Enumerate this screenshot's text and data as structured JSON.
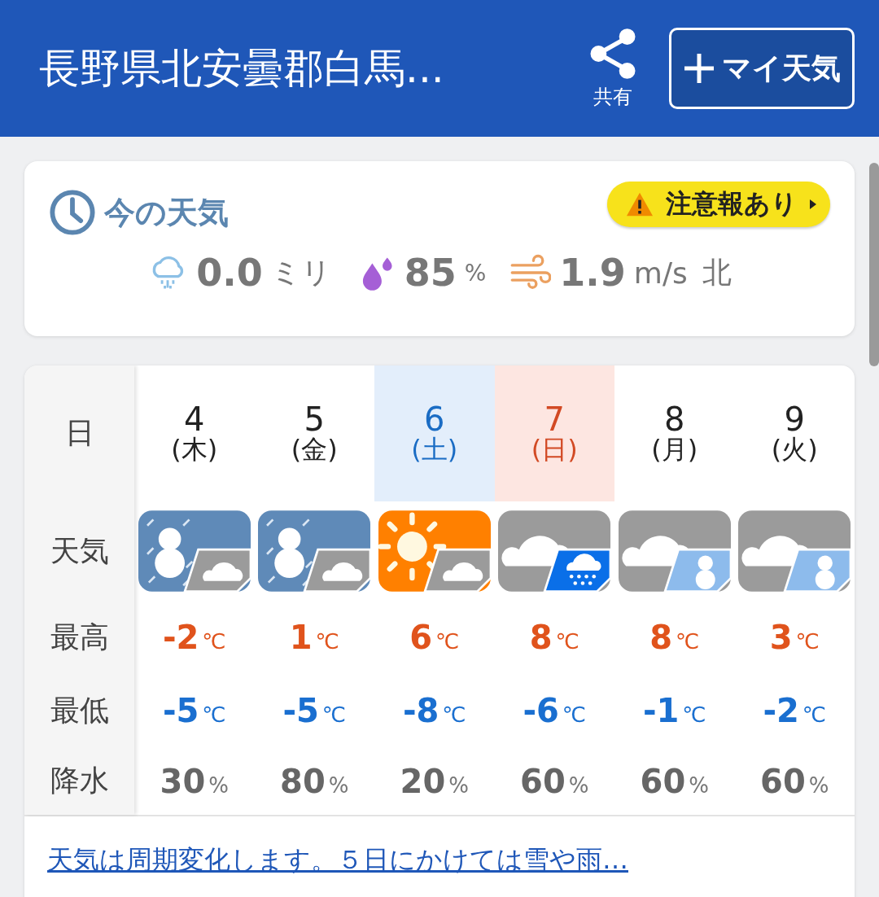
{
  "header": {
    "title": "長野県北安曇郡白馬...",
    "share_label": "共有",
    "my_weather_button": "マイ天気"
  },
  "current": {
    "title": "今の天気",
    "alert": "注意報あり",
    "precip_value": "0.0",
    "precip_unit": "ミリ",
    "humidity_value": "85",
    "humidity_unit": "%",
    "wind_value": "1.9",
    "wind_unit": "m/s",
    "wind_dir": "北"
  },
  "forecast": {
    "row_labels": [
      "日",
      "天気",
      "最高",
      "最低",
      "降水"
    ],
    "days": [
      {
        "date": "4",
        "weekday": "(木)",
        "kind": "weekday",
        "weather": [
          {
            "kind": "snow"
          },
          {
            "kind": "cloudy"
          }
        ],
        "high": "-2",
        "low": "-5",
        "precip": "30"
      },
      {
        "date": "5",
        "weekday": "(金)",
        "kind": "weekday",
        "weather": [
          {
            "kind": "snow"
          },
          {
            "kind": "cloudy"
          }
        ],
        "high": "1",
        "low": "-5",
        "precip": "80"
      },
      {
        "date": "6",
        "weekday": "(土)",
        "kind": "saturday",
        "weather": [
          {
            "kind": "sunny"
          },
          {
            "kind": "cloudy"
          }
        ],
        "high": "6",
        "low": "-8",
        "precip": "20"
      },
      {
        "date": "7",
        "weekday": "(日)",
        "kind": "sunday",
        "weather": [
          {
            "kind": "cloudy"
          },
          {
            "kind": "rain"
          }
        ],
        "high": "8",
        "low": "-6",
        "precip": "60"
      },
      {
        "date": "8",
        "weekday": "(月)",
        "kind": "weekday",
        "weather": [
          {
            "kind": "cloudy"
          },
          {
            "kind": "snow"
          }
        ],
        "high": "8",
        "low": "-1",
        "precip": "60"
      },
      {
        "date": "9",
        "weekday": "(火)",
        "kind": "weekday",
        "weather": [
          {
            "kind": "cloudy"
          },
          {
            "kind": "snow"
          }
        ],
        "high": "3",
        "low": "-2",
        "precip": "60"
      }
    ],
    "temp_unit": "℃",
    "precip_unit": "%"
  },
  "summary_link": "天気は周期変化します。５日にかけては雪や雨…"
}
